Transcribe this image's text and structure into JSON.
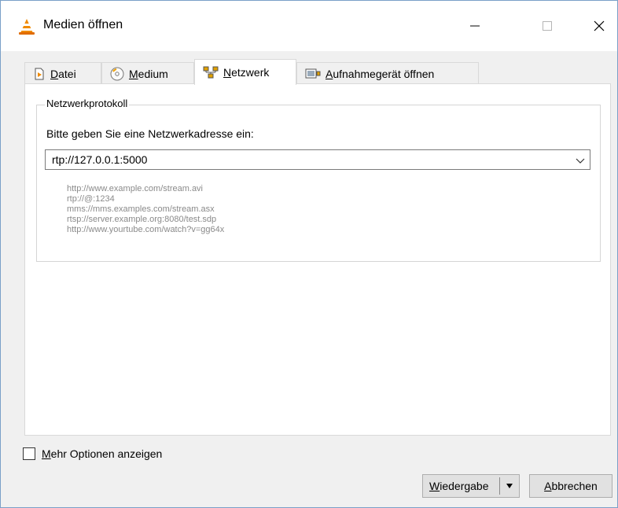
{
  "window": {
    "title": "Medien öffnen",
    "buttons": {
      "minimize": "—",
      "maximize": "□",
      "close": "✕"
    }
  },
  "tabs": [
    {
      "label": "Datei",
      "mnemonic": "D",
      "icon": "file-icon",
      "active": false
    },
    {
      "label": "Medium",
      "mnemonic": "M",
      "icon": "disc-icon",
      "active": false
    },
    {
      "label": "Netzwerk",
      "mnemonic": "N",
      "icon": "network-icon",
      "active": true
    },
    {
      "label": "Aufnahmegerät öffnen",
      "mnemonic": "A",
      "icon": "capture-device-icon",
      "active": false
    }
  ],
  "network": {
    "group_title": "Netzwerkprotokoll",
    "prompt": "Bitte geben Sie eine Netzwerkadresse ein:",
    "url_value": "rtp://127.0.0.1:5000",
    "examples": [
      "http://www.example.com/stream.avi",
      "rtp://@:1234",
      "mms://mms.examples.com/stream.asx",
      "rtsp://server.example.org:8080/test.sdp",
      "http://www.yourtube.com/watch?v=gg64x"
    ]
  },
  "options": {
    "more_options_label": "Mehr Optionen anzeigen",
    "more_options_mnemonic": "M",
    "checked": false
  },
  "footer": {
    "play_label": "Wiedergabe",
    "play_mnemonic": "W",
    "cancel_label": "Abbrechen",
    "cancel_mnemonic": "A"
  },
  "colors": {
    "window_bg": "#f0f0f0",
    "panel_bg": "#ffffff",
    "titlebar_bg": "#ffffff",
    "example_text": "#8a8a8a",
    "vlc_orange": "#f08a00"
  }
}
